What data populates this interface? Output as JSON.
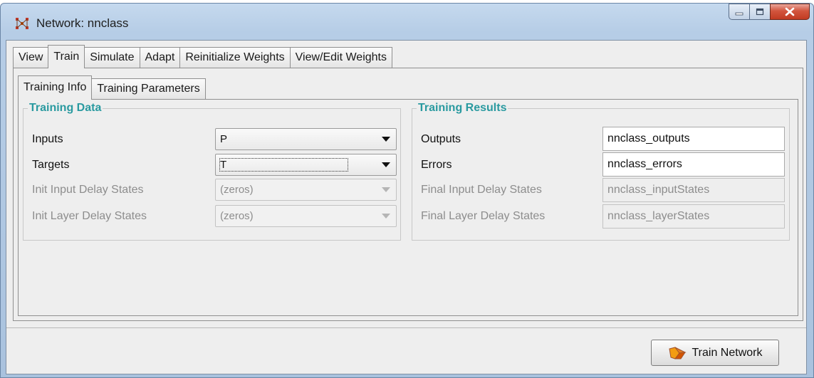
{
  "window": {
    "title": "Network: nnclass",
    "icon": "network-icon"
  },
  "main_tabs": [
    {
      "label": "View"
    },
    {
      "label": "Train",
      "active": true
    },
    {
      "label": "Simulate"
    },
    {
      "label": "Adapt"
    },
    {
      "label": "Reinitialize Weights"
    },
    {
      "label": "View/Edit Weights"
    }
  ],
  "sub_tabs": [
    {
      "label": "Training Info",
      "active": true
    },
    {
      "label": "Training Parameters"
    }
  ],
  "training_data": {
    "title": "Training Data",
    "rows": [
      {
        "label": "Inputs",
        "value": "P",
        "enabled": true
      },
      {
        "label": "Targets",
        "value": "T",
        "enabled": true
      },
      {
        "label": "Init Input Delay States",
        "value": "(zeros)",
        "enabled": false
      },
      {
        "label": "Init Layer Delay States",
        "value": "(zeros)",
        "enabled": false
      }
    ]
  },
  "training_results": {
    "title": "Training Results",
    "rows": [
      {
        "label": "Outputs",
        "value": "nnclass_outputs",
        "enabled": true
      },
      {
        "label": "Errors",
        "value": "nnclass_errors",
        "enabled": true
      },
      {
        "label": "Final Input Delay States",
        "value": "nnclass_inputStates",
        "enabled": false
      },
      {
        "label": "Final Layer Delay States",
        "value": "nnclass_layerStates",
        "enabled": false
      }
    ]
  },
  "actions": {
    "train_label": "Train Network",
    "train_icon": "train-network-icon"
  },
  "colors": {
    "group_title": "#2a9aa0",
    "disabled_text": "#8d8d8d",
    "close_button": "#c13b22"
  }
}
